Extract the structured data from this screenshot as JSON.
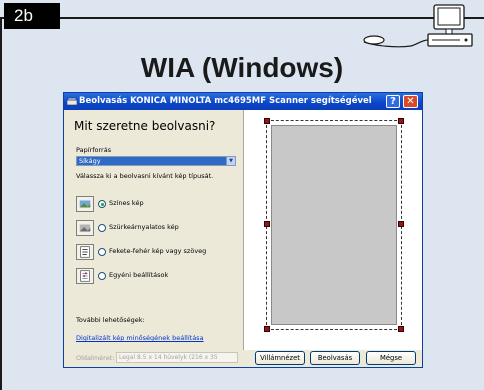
{
  "badge": "2b",
  "heading": "WIA (Windows)",
  "dialog": {
    "title": "Beolvasás KONICA MINOLTA mc4695MF Scanner segítségével",
    "help_label": "?",
    "close_label": "✕",
    "question": "Mit szeretne beolvasni?",
    "paper_source_label": "Papírforrás",
    "paper_source_value": "Síkágy",
    "picture_type_prompt": "Válassza ki a beolvasni kívánt kép típusát.",
    "picture_types": [
      {
        "label": "Színes kép",
        "selected": true,
        "icon": "color-picture-icon"
      },
      {
        "label": "Szürkeárnyalatos kép",
        "selected": false,
        "icon": "grayscale-picture-icon"
      },
      {
        "label": "Fekete-fehér kép vagy szöveg",
        "selected": false,
        "icon": "bw-text-icon"
      },
      {
        "label": "Egyéni beállítások",
        "selected": false,
        "icon": "custom-settings-icon"
      }
    ],
    "more_options_label": "További lehetőségek:",
    "adjust_quality_link": "Digitalizált kép minőségének beállítása",
    "page_size_label": "Oldalméret:",
    "page_size_value": "Legal 8.5 x 14 hüvelyk (216 x 35",
    "buttons": {
      "preview": "Villámnézet",
      "scan": "Beolvasás",
      "cancel": "Mégse"
    }
  },
  "colors": {
    "titlebar": "#0a46c8",
    "dialog_bg": "#ece9d8",
    "card_bg": "#dde6f0",
    "link": "#0033cc",
    "handle": "#8b1a1a"
  }
}
